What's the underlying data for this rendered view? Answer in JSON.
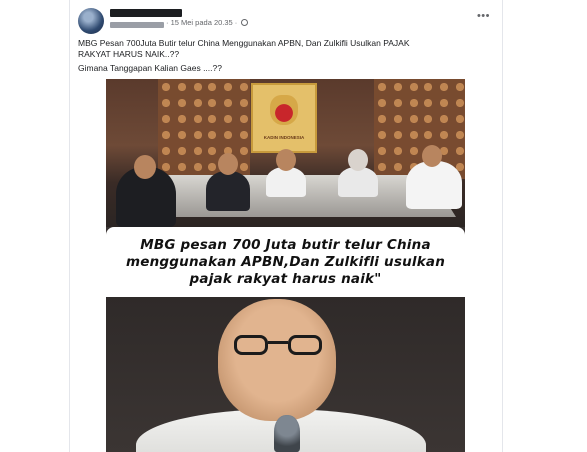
{
  "post": {
    "meta_text": "· 15 Mei pada 20.35 ·",
    "more_icon": "more-horizontal-icon",
    "privacy_icon": "globe-icon",
    "caption_line1": "MBG Pesan 700Juta Butir telur China Menggunakan APBN, Dan Zulkifli Usulkan PAJAK RAKYAT HARUS NAIK..??",
    "caption_line2": "Gimana Tanggapan Kalian Gaes ....??"
  },
  "media": {
    "emblem_text": "KADIN INDONESIA",
    "overlay_line1": "MBG pesan 700 Juta butir telur China",
    "overlay_line2": "menggunakan APBN,Dan Zulkifli usulkan",
    "overlay_line3": "pajak rakyat harus naik\""
  },
  "colors": {
    "text_primary": "#1c1e21",
    "text_secondary": "#65676b"
  }
}
